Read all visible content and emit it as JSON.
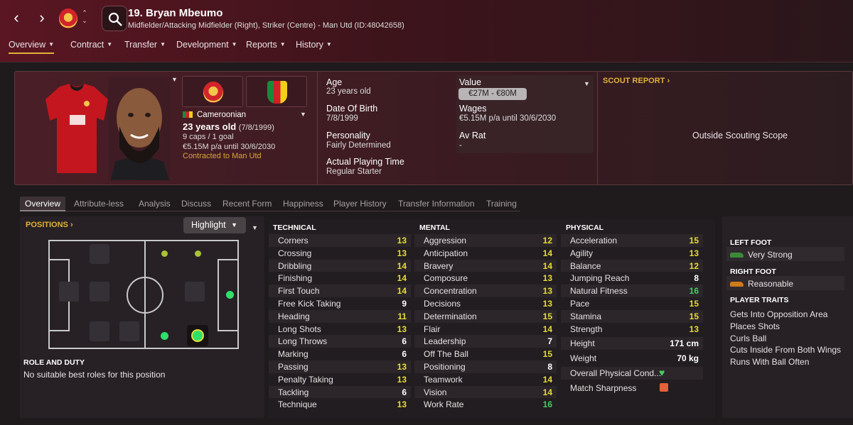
{
  "header": {
    "player_name": "19. Bryan Mbeumo",
    "player_subtitle": "Midfielder/Attacking Midfielder (Right), Striker (Centre) - Man Utd (ID:48042658)",
    "back_icon": "chevron-left-icon",
    "forward_icon": "chevron-right-icon"
  },
  "tabs": [
    {
      "label": "Overview",
      "active": true
    },
    {
      "label": "Contract"
    },
    {
      "label": "Transfer"
    },
    {
      "label": "Development"
    },
    {
      "label": "Reports"
    },
    {
      "label": "History"
    }
  ],
  "profile": {
    "nationality": "Cameroonian",
    "age_line": "23 years old",
    "age_dob": "(7/8/1999)",
    "caps": "9 caps / 1 goal",
    "wage_line": "€5.15M p/a until 30/6/2030",
    "contract_line": "Contracted to Man Utd"
  },
  "info": {
    "age_label": "Age",
    "age_value": "23 years old",
    "dob_label": "Date Of Birth",
    "dob_value": "7/8/1999",
    "personality_label": "Personality",
    "personality_value": "Fairly Determined",
    "playtime_label": "Actual Playing Time",
    "playtime_value": "Regular Starter",
    "value_label": "Value",
    "value_value": "€27M - €80M",
    "wages_label": "Wages",
    "wages_value": "€5.15M p/a until 30/6/2030",
    "avrat_label": "Av Rat",
    "avrat_value": "-"
  },
  "scout": {
    "label": "SCOUT REPORT",
    "scope": "Outside Scouting Scope"
  },
  "subtabs": [
    "Overview",
    "Attribute-less",
    "Analysis",
    "Discuss",
    "Recent Form",
    "Happiness",
    "Player History",
    "Transfer Information",
    "Training"
  ],
  "positions": {
    "label": "POSITIONS",
    "highlight": "Highlight",
    "role_label": "ROLE AND DUTY",
    "role_value": "No suitable best roles for this position"
  },
  "attributes": {
    "technical_label": "TECHNICAL",
    "mental_label": "MENTAL",
    "physical_label": "PHYSICAL",
    "technical": [
      [
        "Corners",
        "13"
      ],
      [
        "Crossing",
        "13"
      ],
      [
        "Dribbling",
        "14"
      ],
      [
        "Finishing",
        "14"
      ],
      [
        "First Touch",
        "14"
      ],
      [
        "Free Kick Taking",
        "9"
      ],
      [
        "Heading",
        "11"
      ],
      [
        "Long Shots",
        "13"
      ],
      [
        "Long Throws",
        "6"
      ],
      [
        "Marking",
        "6"
      ],
      [
        "Passing",
        "13"
      ],
      [
        "Penalty Taking",
        "13"
      ],
      [
        "Tackling",
        "6"
      ],
      [
        "Technique",
        "13"
      ]
    ],
    "mental": [
      [
        "Aggression",
        "12"
      ],
      [
        "Anticipation",
        "14"
      ],
      [
        "Bravery",
        "14"
      ],
      [
        "Composure",
        "13"
      ],
      [
        "Concentration",
        "13"
      ],
      [
        "Decisions",
        "13"
      ],
      [
        "Determination",
        "15"
      ],
      [
        "Flair",
        "14"
      ],
      [
        "Leadership",
        "7"
      ],
      [
        "Off The Ball",
        "15"
      ],
      [
        "Positioning",
        "8"
      ],
      [
        "Teamwork",
        "14"
      ],
      [
        "Vision",
        "14"
      ],
      [
        "Work Rate",
        "16"
      ]
    ],
    "physical": [
      [
        "Acceleration",
        "15"
      ],
      [
        "Agility",
        "13"
      ],
      [
        "Balance",
        "12"
      ],
      [
        "Jumping Reach",
        "8"
      ],
      [
        "Natural Fitness",
        "16"
      ],
      [
        "Pace",
        "15"
      ],
      [
        "Stamina",
        "15"
      ],
      [
        "Strength",
        "13"
      ]
    ],
    "height_label": "Height",
    "height_value": "171 cm",
    "weight_label": "Weight",
    "weight_value": "70 kg",
    "condition_label": "Overall Physical Cond...",
    "sharpness_label": "Match Sharpness"
  },
  "feet": {
    "left_label": "LEFT FOOT",
    "left_value": "Very Strong",
    "right_label": "RIGHT FOOT",
    "right_value": "Reasonable"
  },
  "traits": {
    "label": "PLAYER TRAITS",
    "items": [
      "Gets Into Opposition Area",
      "Places Shots",
      "Curls Ball",
      "Cuts Inside From Both Wings",
      "Runs With Ball Often"
    ]
  },
  "colors": {
    "accent": "#e2b23a",
    "high": "#3fd160",
    "mid": "#e6dd33",
    "header": "#5a1622"
  }
}
